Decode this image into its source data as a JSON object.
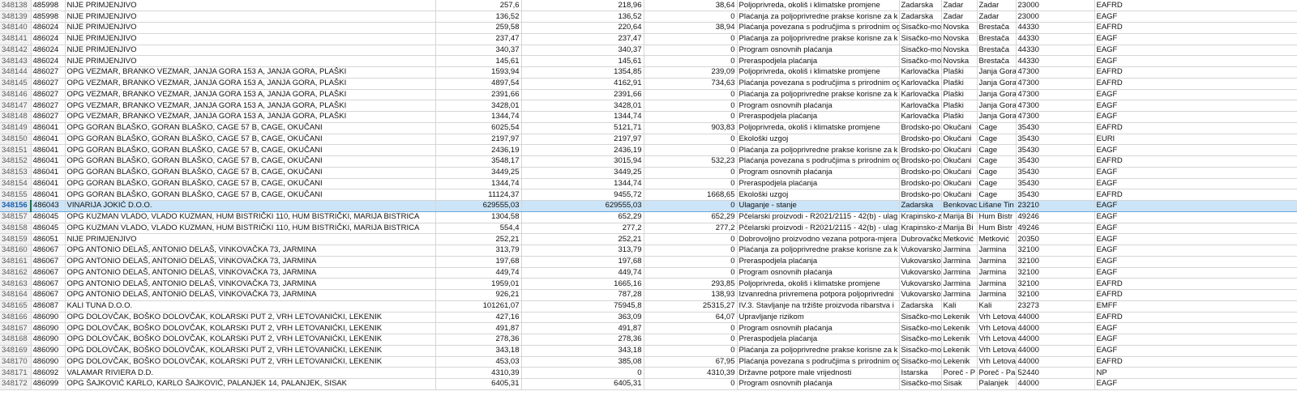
{
  "sheet": {
    "selected_row": "348156",
    "rows": [
      {
        "row": "348138",
        "a": "485998",
        "b": "NIJE PRIMJENJIVO",
        "c": "257,6",
        "d": "218,96",
        "e": "38,64",
        "f": "Poljoprivreda, okoliš i klimatske promjene",
        "g": "Zadarska",
        "h": "Zadar",
        "i": "Zadar",
        "j": "23000",
        "k": "EAFRD"
      },
      {
        "row": "348139",
        "a": "485998",
        "b": "NIJE PRIMJENJIVO",
        "c": "136,52",
        "d": "136,52",
        "e": "0",
        "f": "Plaćanja za poljoprivredne prakse korisne za k",
        "g": "Zadarska",
        "h": "Zadar",
        "i": "Zadar",
        "j": "23000",
        "k": "EAGF"
      },
      {
        "row": "348140",
        "a": "486024",
        "b": "NIJE PRIMJENJIVO",
        "c": "259,58",
        "d": "220,64",
        "e": "38,94",
        "f": "Plaćanja povezana s područjima s prirodnim ogr",
        "g": "Sisačko-mo",
        "h": "Novska",
        "i": "Brestača",
        "j": "44330",
        "k": "EAFRD"
      },
      {
        "row": "348141",
        "a": "486024",
        "b": "NIJE PRIMJENJIVO",
        "c": "237,47",
        "d": "237,47",
        "e": "0",
        "f": "Plaćanja za poljoprivredne prakse korisne za k",
        "g": "Sisačko-mo",
        "h": "Novska",
        "i": "Brestača",
        "j": "44330",
        "k": "EAGF"
      },
      {
        "row": "348142",
        "a": "486024",
        "b": "NIJE PRIMJENJIVO",
        "c": "340,37",
        "d": "340,37",
        "e": "0",
        "f": "Program osnovnih plaćanja",
        "g": "Sisačko-mo",
        "h": "Novska",
        "i": "Brestača",
        "j": "44330",
        "k": "EAGF"
      },
      {
        "row": "348143",
        "a": "486024",
        "b": "NIJE PRIMJENJIVO",
        "c": "145,61",
        "d": "145,61",
        "e": "0",
        "f": "Preraspodjela plaćanja",
        "g": "Sisačko-mo",
        "h": "Novska",
        "i": "Brestača",
        "j": "44330",
        "k": "EAGF"
      },
      {
        "row": "348144",
        "a": "486027",
        "b": "OPG VEZMAR, BRANKO VEZMAR, JANJA GORA 153 A, JANJA GORA, PLAŠKI",
        "c": "1593,94",
        "d": "1354,85",
        "e": "239,09",
        "f": "Poljoprivreda, okoliš i klimatske promjene",
        "g": "Karlovačka",
        "h": "Plaški",
        "i": "Janja Gora",
        "j": "47300",
        "k": "EAFRD"
      },
      {
        "row": "348145",
        "a": "486027",
        "b": "OPG VEZMAR, BRANKO VEZMAR, JANJA GORA 153 A, JANJA GORA, PLAŠKI",
        "c": "4897,54",
        "d": "4162,91",
        "e": "734,63",
        "f": "Plaćanja povezana s područjima s prirodnim ogr",
        "g": "Karlovačka",
        "h": "Plaški",
        "i": "Janja Gora",
        "j": "47300",
        "k": "EAFRD"
      },
      {
        "row": "348146",
        "a": "486027",
        "b": "OPG VEZMAR, BRANKO VEZMAR, JANJA GORA 153 A, JANJA GORA, PLAŠKI",
        "c": "2391,66",
        "d": "2391,66",
        "e": "0",
        "f": "Plaćanja za poljoprivredne prakse korisne za k",
        "g": "Karlovačka",
        "h": "Plaški",
        "i": "Janja Gora",
        "j": "47300",
        "k": "EAGF"
      },
      {
        "row": "348147",
        "a": "486027",
        "b": "OPG VEZMAR, BRANKO VEZMAR, JANJA GORA 153 A, JANJA GORA, PLAŠKI",
        "c": "3428,01",
        "d": "3428,01",
        "e": "0",
        "f": "Program osnovnih plaćanja",
        "g": "Karlovačka",
        "h": "Plaški",
        "i": "Janja Gora",
        "j": "47300",
        "k": "EAGF"
      },
      {
        "row": "348148",
        "a": "486027",
        "b": "OPG VEZMAR, BRANKO VEZMAR, JANJA GORA 153 A, JANJA GORA, PLAŠKI",
        "c": "1344,74",
        "d": "1344,74",
        "e": "0",
        "f": "Preraspodjela plaćanja",
        "g": "Karlovačka",
        "h": "Plaški",
        "i": "Janja Gora",
        "j": "47300",
        "k": "EAGF"
      },
      {
        "row": "348149",
        "a": "486041",
        "b": "OPG GORAN BLAŠKO, GORAN BLAŠKO, CAGE 57 B, CAGE, OKUČANI",
        "c": "6025,54",
        "d": "5121,71",
        "e": "903,83",
        "f": "Poljoprivreda, okoliš i klimatske promjene",
        "g": "Brodsko-po",
        "h": "Okučani",
        "i": "Cage",
        "j": "35430",
        "k": "EAFRD"
      },
      {
        "row": "348150",
        "a": "486041",
        "b": "OPG GORAN BLAŠKO, GORAN BLAŠKO, CAGE 57 B, CAGE, OKUČANI",
        "c": "2197,97",
        "d": "2197,97",
        "e": "0",
        "f": "Ekološki uzgoj",
        "g": "Brodsko-po",
        "h": "Okučani",
        "i": "Cage",
        "j": "35430",
        "k": "EURI"
      },
      {
        "row": "348151",
        "a": "486041",
        "b": "OPG GORAN BLAŠKO, GORAN BLAŠKO, CAGE 57 B, CAGE, OKUČANI",
        "c": "2436,19",
        "d": "2436,19",
        "e": "0",
        "f": "Plaćanja za poljoprivredne prakse korisne za k",
        "g": "Brodsko-po",
        "h": "Okučani",
        "i": "Cage",
        "j": "35430",
        "k": "EAGF"
      },
      {
        "row": "348152",
        "a": "486041",
        "b": "OPG GORAN BLAŠKO, GORAN BLAŠKO, CAGE 57 B, CAGE, OKUČANI",
        "c": "3548,17",
        "d": "3015,94",
        "e": "532,23",
        "f": "Plaćanja povezana s područjima s prirodnim ogr",
        "g": "Brodsko-po",
        "h": "Okučani",
        "i": "Cage",
        "j": "35430",
        "k": "EAFRD"
      },
      {
        "row": "348153",
        "a": "486041",
        "b": "OPG GORAN BLAŠKO, GORAN BLAŠKO, CAGE 57 B, CAGE, OKUČANI",
        "c": "3449,25",
        "d": "3449,25",
        "e": "0",
        "f": "Program osnovnih plaćanja",
        "g": "Brodsko-po",
        "h": "Okučani",
        "i": "Cage",
        "j": "35430",
        "k": "EAGF"
      },
      {
        "row": "348154",
        "a": "486041",
        "b": "OPG GORAN BLAŠKO, GORAN BLAŠKO, CAGE 57 B, CAGE, OKUČANI",
        "c": "1344,74",
        "d": "1344,74",
        "e": "0",
        "f": "Preraspodjela plaćanja",
        "g": "Brodsko-po",
        "h": "Okučani",
        "i": "Cage",
        "j": "35430",
        "k": "EAGF"
      },
      {
        "row": "348155",
        "a": "486041",
        "b": "OPG GORAN BLAŠKO, GORAN BLAŠKO, CAGE 57 B, CAGE, OKUČANI",
        "c": "11124,37",
        "d": "9455,72",
        "e": "1668,65",
        "f": "Ekološki uzgoj",
        "g": "Brodsko-po",
        "h": "Okučani",
        "i": "Cage",
        "j": "35430",
        "k": "EAFRD"
      },
      {
        "row": "348156",
        "a": "486043",
        "b": "VINARIJA JOKIĆ D.O.O.",
        "c": "629555,03",
        "d": "629555,03",
        "e": "0",
        "f": "Ulaganje - stanje",
        "g": "Zadarska",
        "h": "Benkovac",
        "i": "Lišane Tin",
        "j": "23210",
        "k": "EAGF"
      },
      {
        "row": "348157",
        "a": "486045",
        "b": "OPG KUZMAN VLADO, VLADO KUZMAN, HUM BISTRIČKI 110, HUM BISTRIČKI, MARIJA BISTRICA",
        "c": "1304,58",
        "d": "652,29",
        "e": "652,29",
        "f": "Pčelarski proizvodi - R2021/2115 - 42(b) - ulag",
        "g": "Krapinsko-z",
        "h": "Marija Bi",
        "i": "Hum Bistr",
        "j": "49246",
        "k": "EAGF"
      },
      {
        "row": "348158",
        "a": "486045",
        "b": "OPG KUZMAN VLADO, VLADO KUZMAN, HUM BISTRIČKI 110, HUM BISTRIČKI, MARIJA BISTRICA",
        "c": "554,4",
        "d": "277,2",
        "e": "277,2",
        "f": "Pčelarski proizvodi - R2021/2115 - 42(b) - ulag",
        "g": "Krapinsko-z",
        "h": "Marija Bi",
        "i": "Hum Bistr",
        "j": "49246",
        "k": "EAGF"
      },
      {
        "row": "348159",
        "a": "486051",
        "b": "NIJE PRIMJENJIVO",
        "c": "252,21",
        "d": "252,21",
        "e": "0",
        "f": "Dobrovoljno proizvodno vezana potpora-mjera",
        "g": "Dubrovačko",
        "h": "Metković",
        "i": "Metković",
        "j": "20350",
        "k": "EAGF"
      },
      {
        "row": "348160",
        "a": "486067",
        "b": "OPG  ANTONIO DELAŠ, ANTONIO DELAŠ, VINKOVAČKA 73, JARMINA",
        "c": "313,79",
        "d": "313,79",
        "e": "0",
        "f": "Plaćanja za poljoprivredne prakse korisne za k",
        "g": "Vukovarsko",
        "h": "Jarmina",
        "i": "Jarmina",
        "j": "32100",
        "k": "EAGF"
      },
      {
        "row": "348161",
        "a": "486067",
        "b": "OPG  ANTONIO DELAŠ, ANTONIO DELAŠ, VINKOVAČKA 73, JARMINA",
        "c": "197,68",
        "d": "197,68",
        "e": "0",
        "f": "Preraspodjela plaćanja",
        "g": "Vukovarsko",
        "h": "Jarmina",
        "i": "Jarmina",
        "j": "32100",
        "k": "EAGF"
      },
      {
        "row": "348162",
        "a": "486067",
        "b": "OPG  ANTONIO DELAŠ, ANTONIO DELAŠ, VINKOVAČKA 73, JARMINA",
        "c": "449,74",
        "d": "449,74",
        "e": "0",
        "f": "Program osnovnih plaćanja",
        "g": "Vukovarsko",
        "h": "Jarmina",
        "i": "Jarmina",
        "j": "32100",
        "k": "EAGF"
      },
      {
        "row": "348163",
        "a": "486067",
        "b": "OPG  ANTONIO DELAŠ, ANTONIO DELAŠ, VINKOVAČKA 73, JARMINA",
        "c": "1959,01",
        "d": "1665,16",
        "e": "293,85",
        "f": "Poljoprivreda, okoliš i klimatske promjene",
        "g": "Vukovarsko",
        "h": "Jarmina",
        "i": "Jarmina",
        "j": "32100",
        "k": "EAFRD"
      },
      {
        "row": "348164",
        "a": "486067",
        "b": "OPG  ANTONIO DELAŠ, ANTONIO DELAŠ, VINKOVAČKA 73, JARMINA",
        "c": "926,21",
        "d": "787,28",
        "e": "138,93",
        "f": "Izvanredna privremena potpora poljoprivredni",
        "g": "Vukovarsko",
        "h": "Jarmina",
        "i": "Jarmina",
        "j": "32100",
        "k": "EAFRD"
      },
      {
        "row": "348165",
        "a": "486087",
        "b": "KALI TUNA D.O.O.",
        "c": "101261,07",
        "d": "75945,8",
        "e": "25315,27",
        "f": "IV.3. Stavljanje na tržište proizvoda ribarstva i",
        "g": "Zadarska",
        "h": "Kali",
        "i": "Kali",
        "j": "23273",
        "k": "EMFF"
      },
      {
        "row": "348166",
        "a": "486090",
        "b": "OPG DOLOVČAK, BOŠKO DOLOVČAK, KOLARSKI PUT 2, VRH LETOVANIĆKI, LEKENIK",
        "c": "427,16",
        "d": "363,09",
        "e": "64,07",
        "f": "Upravljanje rizikom",
        "g": "Sisačko-mo",
        "h": "Lekenik",
        "i": "Vrh Letova",
        "j": "44000",
        "k": "EAFRD"
      },
      {
        "row": "348167",
        "a": "486090",
        "b": "OPG DOLOVČAK, BOŠKO DOLOVČAK, KOLARSKI PUT 2, VRH LETOVANIĆKI, LEKENIK",
        "c": "491,87",
        "d": "491,87",
        "e": "0",
        "f": "Program osnovnih plaćanja",
        "g": "Sisačko-mo",
        "h": "Lekenik",
        "i": "Vrh Letova",
        "j": "44000",
        "k": "EAGF"
      },
      {
        "row": "348168",
        "a": "486090",
        "b": "OPG DOLOVČAK, BOŠKO DOLOVČAK, KOLARSKI PUT 2, VRH LETOVANIĆKI, LEKENIK",
        "c": "278,36",
        "d": "278,36",
        "e": "0",
        "f": "Preraspodjela plaćanja",
        "g": "Sisačko-mo",
        "h": "Lekenik",
        "i": "Vrh Letova",
        "j": "44000",
        "k": "EAGF"
      },
      {
        "row": "348169",
        "a": "486090",
        "b": "OPG DOLOVČAK, BOŠKO DOLOVČAK, KOLARSKI PUT 2, VRH LETOVANIĆKI, LEKENIK",
        "c": "343,18",
        "d": "343,18",
        "e": "0",
        "f": "Plaćanja za poljoprivredne prakse korisne za k",
        "g": "Sisačko-mo",
        "h": "Lekenik",
        "i": "Vrh Letova",
        "j": "44000",
        "k": "EAGF"
      },
      {
        "row": "348170",
        "a": "486090",
        "b": "OPG DOLOVČAK, BOŠKO DOLOVČAK, KOLARSKI PUT 2, VRH LETOVANIĆKI, LEKENIK",
        "c": "453,03",
        "d": "385,08",
        "e": "67,95",
        "f": "Plaćanja povezana s područjima s prirodnim ogr",
        "g": "Sisačko-mo",
        "h": "Lekenik",
        "i": "Vrh Letova",
        "j": "44000",
        "k": "EAFRD"
      },
      {
        "row": "348171",
        "a": "486092",
        "b": "VALAMAR RIVIERA D.D.",
        "c": "4310,39",
        "d": "0",
        "e": "4310,39",
        "f": "Državne potpore male vrijednosti",
        "g": "Istarska",
        "h": "Poreč - P",
        "i": "Poreč - Pa",
        "j": "52440",
        "k": "NP"
      },
      {
        "row": "348172",
        "a": "486099",
        "b": "OPG ŠAJKOVIĆ KARLO, KARLO ŠAJKOVIĆ, PALANJEK 14, PALANJEK, SISAK",
        "c": "6405,31",
        "d": "6405,31",
        "e": "0",
        "f": "Program osnovnih plaćanja",
        "g": "Sisačko-mo",
        "h": "Sisak",
        "i": "Palanjek",
        "j": "44000",
        "k": "EAGF"
      }
    ]
  }
}
